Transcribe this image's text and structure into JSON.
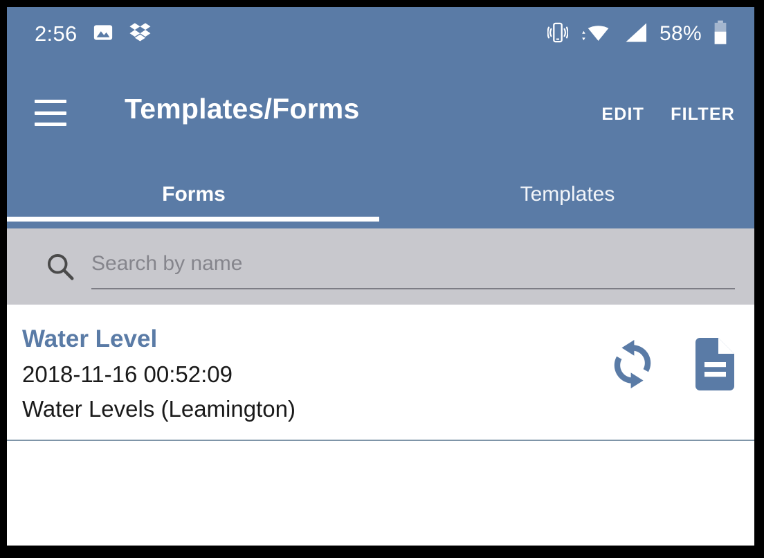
{
  "theme": {
    "primary": "#5a7ba6",
    "search_bg": "#c8c8cd",
    "list_bg": "#ffffff",
    "divider": "#7f95a8",
    "on_primary": "#ffffff",
    "body_text": "#1a1a1a",
    "placeholder_text": "#85858c",
    "frame": "#000000"
  },
  "status_bar": {
    "clock": "2:56",
    "battery_percent": "58%",
    "left_icons": [
      "photo-icon",
      "dropbox-icon"
    ],
    "right_icons": [
      "vibrate-icon",
      "wifi-icon",
      "cellular-signal-icon",
      "battery-icon"
    ]
  },
  "app_bar": {
    "menu_icon": "hamburger-menu-icon",
    "title": "Templates/Forms",
    "actions": [
      {
        "label": "EDIT",
        "name": "edit-button"
      },
      {
        "label": "FILTER",
        "name": "filter-button"
      }
    ]
  },
  "tabs": {
    "selected_index": 0,
    "items": [
      {
        "label": "Forms",
        "name": "tab-forms"
      },
      {
        "label": "Templates",
        "name": "tab-templates"
      }
    ]
  },
  "search": {
    "icon": "search-icon",
    "value": "",
    "placeholder": "Search by name"
  },
  "list": {
    "items": [
      {
        "title": "Water Level",
        "timestamp": "2018-11-16 00:52:09",
        "template": "Water Levels (Leamington)",
        "actions": [
          "sync-icon",
          "document-icon"
        ]
      }
    ]
  }
}
